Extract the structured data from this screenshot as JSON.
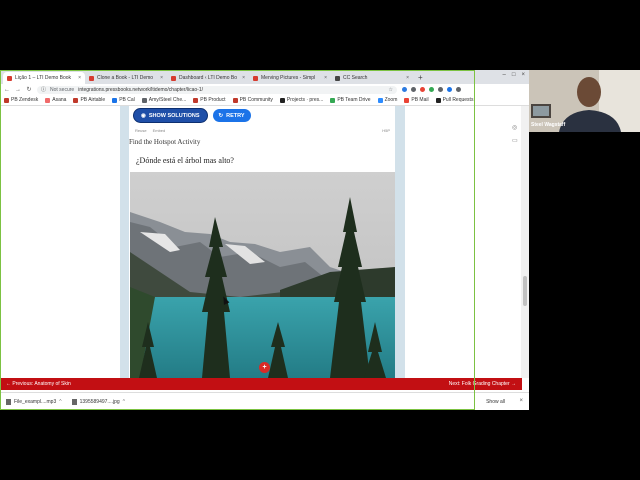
{
  "browser": {
    "tabs": [
      {
        "label": "Lição 1 – LTI Demo Book",
        "active": true,
        "color": "#d63b2f"
      },
      {
        "label": "Clone a Book - LTI Demo",
        "active": false,
        "color": "#d63b2f"
      },
      {
        "label": "Dashboard ‹ LTI Demo Bo",
        "active": false,
        "color": "#d63b2f"
      },
      {
        "label": "Merving Pictures - Simpl",
        "active": false,
        "color": "#d63b2f"
      },
      {
        "label": "CC Search",
        "active": false,
        "color": "#444444"
      }
    ],
    "new_tab_glyph": "+",
    "address": {
      "security": "Not secure",
      "url": "integrations.pressbooks.network/ltidemo/chapter/licao-1/"
    },
    "bookmarks": [
      "PB Zendesk",
      "Asana",
      "PB Airtable",
      "PB Cal",
      "Amy/Steel Che...",
      "PB Product",
      "PB Community",
      "Projects · pres...",
      "PB Team Drive",
      "Zoom",
      "PB Mail",
      "Pull Requests"
    ]
  },
  "activity": {
    "show_solutions_label": "SHOW SOLUTIONS",
    "retry_label": "RETRY",
    "sub_left_1": "Reuse",
    "sub_left_2": "Embed",
    "sub_right": "H5P",
    "title": "Find the Hotspot Activity",
    "question": "¿Dónde está el árbol mas alto?",
    "hotspot_glyph": "+"
  },
  "footer_nav": {
    "previous": "Previous: Anatomy of Skin",
    "next": "Next: Folk Grading Chapter"
  },
  "downloads": {
    "items": [
      "File_exampl....mp3",
      "1395589497....jpg"
    ],
    "show_all": "Show all"
  },
  "webcam": {
    "name": "Steel Wagstaff"
  },
  "colors": {
    "accent_blue": "#1f4fa8",
    "retry_blue": "#1b73e8",
    "footer_red": "#c20f13",
    "frame_green": "#7cc242"
  }
}
